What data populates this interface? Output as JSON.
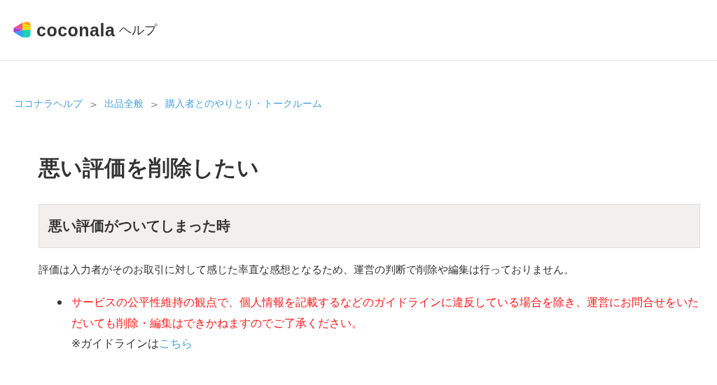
{
  "header": {
    "logo_text": "coconala",
    "suffix": "ヘルプ"
  },
  "breadcrumb": [
    {
      "label": "ココナラヘルプ",
      "separator": ">"
    },
    {
      "label": "出品全般",
      "separator": ">"
    },
    {
      "label": "購入者とのやりとり・トークルーム"
    }
  ],
  "title": "悪い評価を削除したい",
  "section": {
    "heading": "悪い評価がついてしまった時",
    "intro": "評価は入力者がそのお取引に対して感じた率直な感想となるため、運営の判断で削除や編集は行っておりません。",
    "bullets": [
      {
        "warning": "サービスの公平性維持の観点で、個人情報を記載するなどのガイドラインに違反している場合を除き、運営にお問合せをいただいても削除・編集はできかねますのでご了承ください。",
        "note": "※ガイドラインは",
        "link": "こちら"
      }
    ]
  }
}
